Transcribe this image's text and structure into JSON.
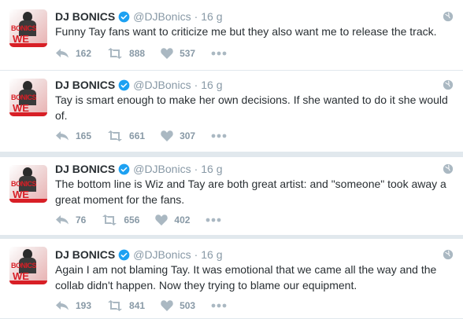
{
  "tweets": [
    {
      "name": "DJ BONICS",
      "handle": "@DJBonics",
      "time": "16 g",
      "text": "Funny Tay fans want to criticize me but they also want me to release the track.",
      "replies": "162",
      "retweets": "888",
      "likes": "537"
    },
    {
      "name": "DJ BONICS",
      "handle": "@DJBonics",
      "time": "16 g",
      "text": "Tay is smart enough to make her own decisions. If she wanted to do it she would of.",
      "replies": "165",
      "retweets": "661",
      "likes": "307"
    },
    {
      "name": "DJ BONICS",
      "handle": "@DJBonics",
      "time": "16 g",
      "text": "The bottom line is Wiz and Tay are both great artist: and \"someone\" took away a great moment for the fans.",
      "replies": "76",
      "retweets": "656",
      "likes": "402"
    },
    {
      "name": "DJ BONICS",
      "handle": "@DJBonics",
      "time": "16 g",
      "text": "Again I am not blaming Tay. It was emotional that we came all the way and the collab didn't happen. Now they trying to blame our equipment.",
      "replies": "193",
      "retweets": "841",
      "likes": "503"
    }
  ],
  "avatar": {
    "top_text": "BONICS",
    "bottom_text": "WE"
  },
  "colors": {
    "accent": "#1da1f2",
    "text": "#292f33",
    "muted": "#8899a6",
    "divider": "#e1e8ed"
  },
  "icons": {
    "reply": "reply-icon",
    "retweet": "retweet-icon",
    "like": "heart-icon",
    "more": "more-icon",
    "verified": "verified-icon",
    "globe": "globe-icon"
  }
}
